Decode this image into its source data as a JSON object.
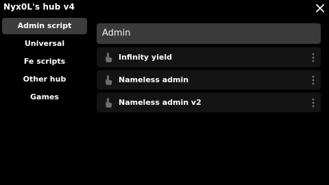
{
  "window": {
    "title": "Nyx0L's hub v4"
  },
  "close_icon": "close-icon",
  "sidebar": {
    "items": [
      {
        "label": "Admin script",
        "active": true
      },
      {
        "label": "Universal",
        "active": false
      },
      {
        "label": "Fe scripts",
        "active": false
      },
      {
        "label": "Other hub",
        "active": false
      },
      {
        "label": "Games",
        "active": false
      }
    ]
  },
  "main": {
    "header": "Admin",
    "scripts": [
      {
        "label": "Infinity yield",
        "icon": "hand-pointer-icon"
      },
      {
        "label": "Nameless admin",
        "icon": "hand-pointer-icon"
      },
      {
        "label": "Nameless admin v2",
        "icon": "hand-pointer-icon"
      }
    ]
  },
  "colors": {
    "background": "#000000",
    "active_tab": "#3c3c3c",
    "header_bar": "#3a3a3a",
    "row": "#141414",
    "text": "#ffffff",
    "icon": "#6e6e6e"
  }
}
